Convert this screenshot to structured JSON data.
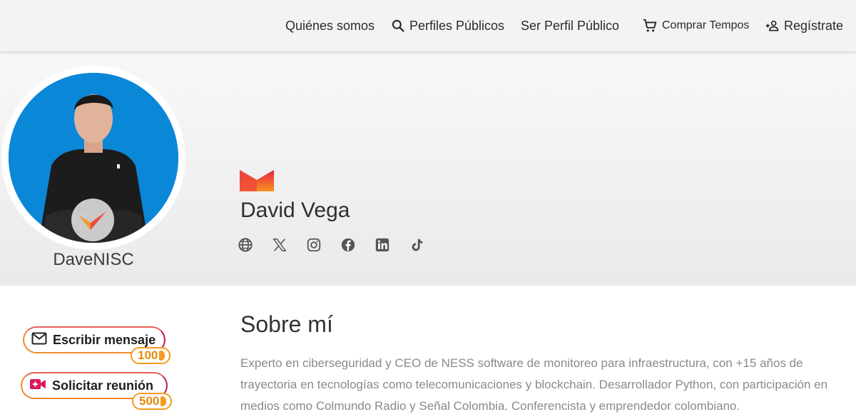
{
  "nav": {
    "about_us": "Quiénes somos",
    "public_profiles": "Perfiles Públicos",
    "be_public": "Ser Perfil Público",
    "buy_tempos": "Comprar Tempos",
    "register": "Regístrate"
  },
  "profile": {
    "username": "DaveNISC",
    "full_name": "David Vega",
    "socials": [
      "globe-icon",
      "x-icon",
      "instagram-icon",
      "facebook-icon",
      "linkedin-icon",
      "tiktok-icon"
    ]
  },
  "actions": {
    "message_label": "Escribir mensaje",
    "message_price": "100",
    "meeting_label": "Solicitar reunión",
    "meeting_price": "500"
  },
  "about": {
    "title": "Sobre mí",
    "text": "Experto en ciberseguridad y CEO de NESS software de monitoreo para infraestructura, con +15 años de trayectoria en tecnologías como telecomunicaciones y blockchain. Desarrollador Python, con participación en medios como Colmundo Radio y Señal Colombia. Conferencista y emprendedor colombiano."
  },
  "colors": {
    "accent_orange": "#f59a1f",
    "accent_magenta": "#c2185b",
    "avatar_bg": "#0b87d8"
  }
}
